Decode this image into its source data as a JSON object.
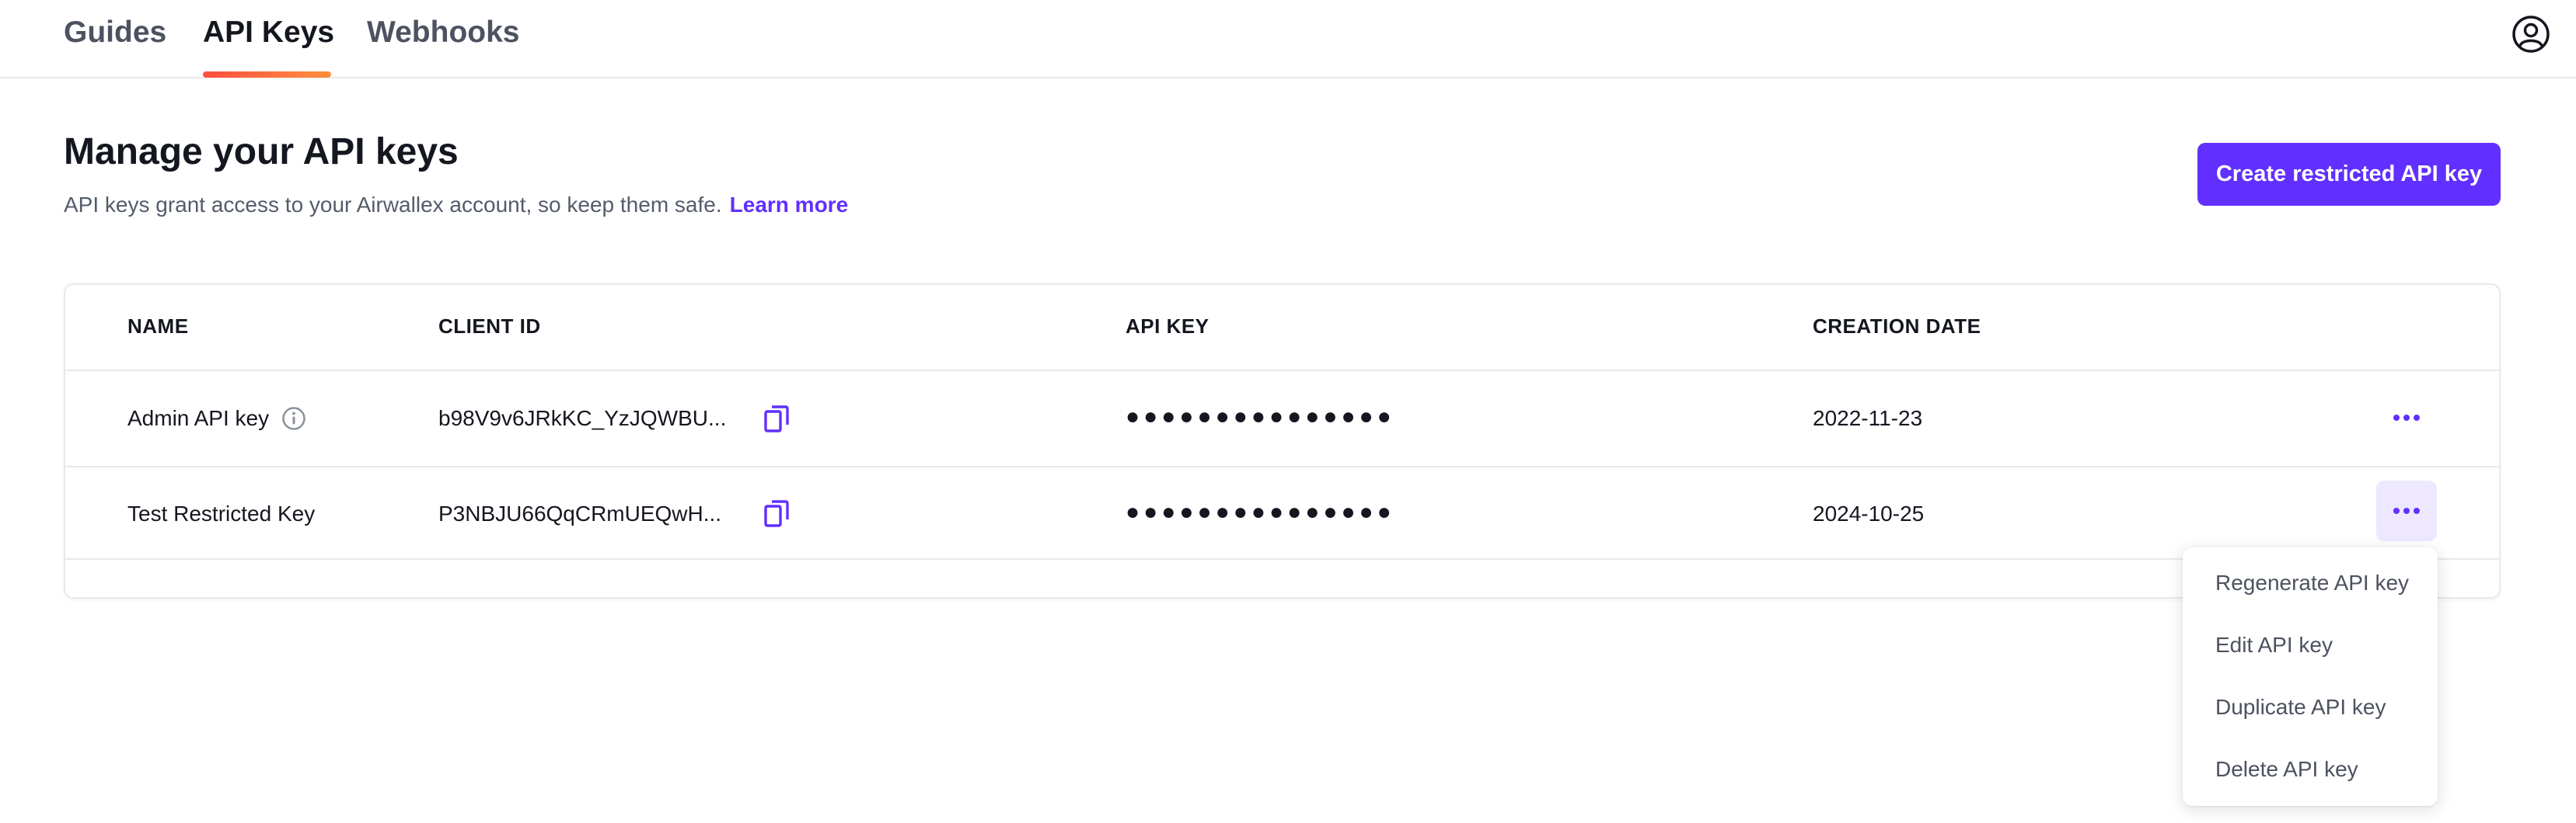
{
  "nav": {
    "tabs": [
      {
        "label": "Guides",
        "active": false
      },
      {
        "label": "API Keys",
        "active": true
      },
      {
        "label": "Webhooks",
        "active": false
      }
    ],
    "profile_icon": "user-circle-icon",
    "accent_gradient": [
      "#ff4f42",
      "#ff8e3c"
    ]
  },
  "page": {
    "title": "Manage your API keys",
    "subtitle": "API keys grant access to your Airwallex account, so keep them safe.",
    "learn_more": "Learn more",
    "create_button": "Create restricted API key"
  },
  "table": {
    "headers": [
      "NAME",
      "CLIENT ID",
      "API KEY",
      "CREATION DATE"
    ],
    "rows": [
      {
        "name": "Admin API key",
        "client_id": "b98V9v6JRkKC_YzJQWBU...",
        "api_key": "●●●●●●●●●●●●●●●",
        "created": "2022-11-23",
        "has_info_icon": true
      },
      {
        "name": "Test Restricted Key",
        "client_id": "P3NBJU66QqCRmUEQwH...",
        "api_key": "●●●●●●●●●●●●●●●",
        "created": "2024-10-25",
        "has_info_icon": false
      }
    ]
  },
  "row_menu": {
    "items": [
      "Regenerate API key",
      "Edit API key",
      "Duplicate API key",
      "Delete API key"
    ]
  },
  "colors": {
    "primary": "#612fff",
    "text": "#14171f",
    "muted": "#545b6b",
    "border": "#e8e9ee"
  }
}
